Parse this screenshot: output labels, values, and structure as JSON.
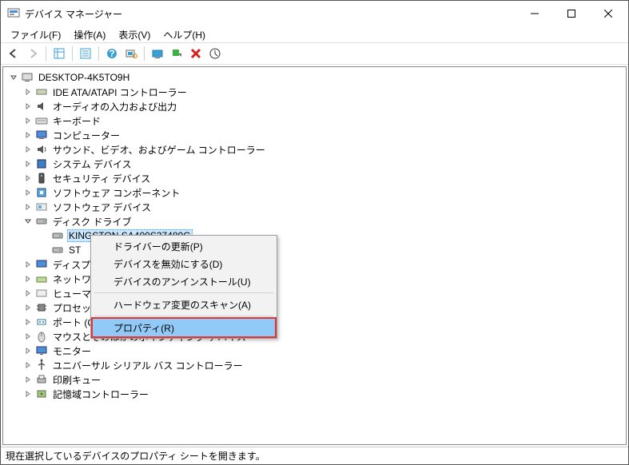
{
  "title": "デバイス マネージャー",
  "menus": {
    "file": "ファイル(F)",
    "action": "操作(A)",
    "view": "表示(V)",
    "help": "ヘルプ(H)"
  },
  "rootNode": "DESKTOP-4K5TO9H",
  "categories": {
    "ata": "IDE ATA/ATAPI コントローラー",
    "audio": "オーディオの入力および出力",
    "keyboard": "キーボード",
    "computer": "コンピューター",
    "svg": "サウンド、ビデオ、およびゲーム コントローラー",
    "system": "システム デバイス",
    "security": "セキュリティ デバイス",
    "swcomp": "ソフトウェア コンポーネント",
    "swdev": "ソフトウェア デバイス",
    "disk": "ディスク ドライブ",
    "display": "ディスプ",
    "network": "ネットワ",
    "hid": "ヒューマ",
    "cpu": "プロセッ",
    "ports": "ポート (C",
    "mouse": "マウスとそのほかのポインティング デバイス",
    "monitor": "モニター",
    "usb": "ユニバーサル シリアル バス コントローラー",
    "printq": "印刷キュー",
    "storage": "記憶域コントローラー"
  },
  "diskItems": {
    "kingston": "KINGSTON SA400S37480G",
    "st": "ST"
  },
  "contextMenu": {
    "updateDriver": "ドライバーの更新(P)",
    "disable": "デバイスを無効にする(D)",
    "uninstall": "デバイスのアンインストール(U)",
    "scan": "ハードウェア変更のスキャン(A)",
    "properties": "プロパティ(R)"
  },
  "status": "現在選択しているデバイスのプロパティ シートを開きます。"
}
